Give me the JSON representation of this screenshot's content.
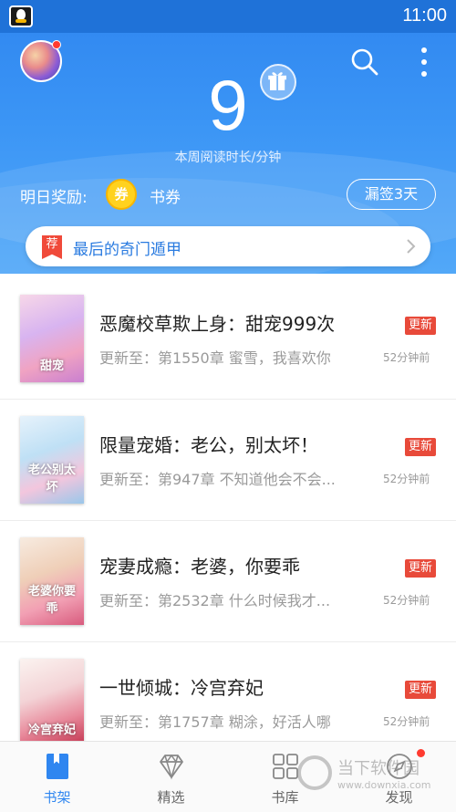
{
  "status_bar": {
    "time": "11:00"
  },
  "header": {
    "minutes_value": "9",
    "minutes_label": "本周阅读时长/分钟",
    "reward_label": "明日奖励:",
    "coupon_badge": "券",
    "reward_text": "书券",
    "missed_button": "漏签3天",
    "colors": {
      "header_top": "#2f86f0",
      "header_bottom": "#52a8f8"
    }
  },
  "recommend": {
    "tag": "荐",
    "title": "最后的奇门遁甲"
  },
  "books": [
    {
      "title": "恶魔校草欺上身：甜宠999次",
      "update": "更新至：第1550章 蜜雪，我喜欢你",
      "badge": "更新",
      "time": "52分钟前",
      "cover_text": "甜宠"
    },
    {
      "title": "限量宠婚：老公，别太坏！",
      "update": "更新至：第947章 不知道他会不会...",
      "badge": "更新",
      "time": "52分钟前",
      "cover_text": "老公别太坏"
    },
    {
      "title": "宠妻成瘾：老婆，你要乖",
      "update": "更新至：第2532章 什么时候我才...",
      "badge": "更新",
      "time": "52分钟前",
      "cover_text": "老婆你要乖"
    },
    {
      "title": "一世倾城：冷宫弃妃",
      "update": "更新至：第1757章 糊涂，好活人哪",
      "badge": "更新",
      "time": "52分钟前",
      "cover_text": "冷宫弃妃"
    }
  ],
  "tabs": [
    {
      "label": "书架",
      "icon": "bookshelf-icon",
      "active": true
    },
    {
      "label": "精选",
      "icon": "diamond-icon",
      "active": false
    },
    {
      "label": "书库",
      "icon": "grid-icon",
      "active": false
    },
    {
      "label": "发现",
      "icon": "compass-icon",
      "active": false
    }
  ],
  "watermark": {
    "name": "当下软件园",
    "url": "www.downxia.com"
  }
}
